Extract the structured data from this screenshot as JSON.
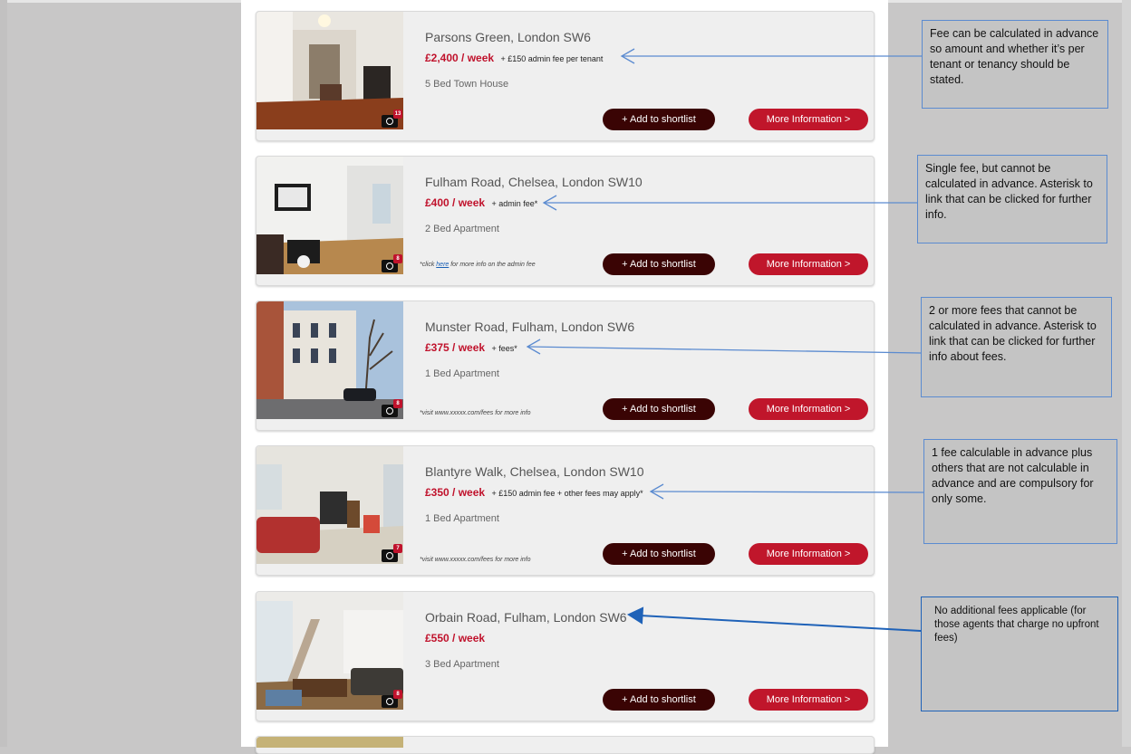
{
  "listings": [
    {
      "address": "Parsons Green, London SW6",
      "price": "£2,400 / week",
      "fee": "+ £150 admin fee per tenant",
      "type": "5 Bed Town House",
      "photo_count": "13",
      "note_prefix": "",
      "note_link": "",
      "note_suffix": "",
      "shortlist_label": "+ Add to shortlist",
      "more_label": "More Information >"
    },
    {
      "address": "Fulham Road, Chelsea, London SW10",
      "price": "£400 / week",
      "fee": "+ admin fee*",
      "type": "2 Bed Apartment",
      "photo_count": "8",
      "note_prefix": "*click ",
      "note_link": "here",
      "note_suffix": " for more info on the admin fee",
      "shortlist_label": "+ Add to shortlist",
      "more_label": "More Information >"
    },
    {
      "address": "Munster Road, Fulham, London SW6",
      "price": "£375 / week",
      "fee": "+ fees*",
      "type": "1 Bed Apartment",
      "photo_count": "8",
      "note_prefix": "*visit www.xxxxx.com/fees for more info",
      "note_link": "",
      "note_suffix": "",
      "shortlist_label": "+ Add to shortlist",
      "more_label": "More Information >"
    },
    {
      "address": "Blantyre Walk, Chelsea, London SW10",
      "price": "£350 / week",
      "fee": "+ £150 admin fee + other fees may apply*",
      "type": "1 Bed Apartment",
      "photo_count": "7",
      "note_prefix": "*visit www.xxxxx.com/fees for more info",
      "note_link": "",
      "note_suffix": "",
      "shortlist_label": "+ Add to shortlist",
      "more_label": "More Information >"
    },
    {
      "address": "Orbain Road, Fulham, London SW6",
      "price": "£550 / week",
      "fee": "",
      "type": "3 Bed Apartment",
      "photo_count": "8",
      "note_prefix": "",
      "note_link": "",
      "note_suffix": "",
      "shortlist_label": "+ Add to shortlist",
      "more_label": "More Information >"
    }
  ],
  "callouts": [
    "Fee can be calculated in advance so amount and whether it’s per tenant or tenancy should be stated.",
    "Single fee, but cannot be calculated in advance. Asterisk to link that can be clicked for further info.",
    "2 or more fees that cannot be calculated in advance. Asterisk to link that can be clicked for further info about fees.",
    "1 fee calculable in advance plus others that are not calculable in advance and are compulsory for only some.",
    "No additional fees applicable (for those agents that charge no upfront fees)"
  ],
  "colors": {
    "price": "#c0122c",
    "shortlist_button": "#3a0404",
    "more_button": "#c0162b",
    "callout_border": "#5b8bd0",
    "arrow": "#5b8bd0"
  }
}
